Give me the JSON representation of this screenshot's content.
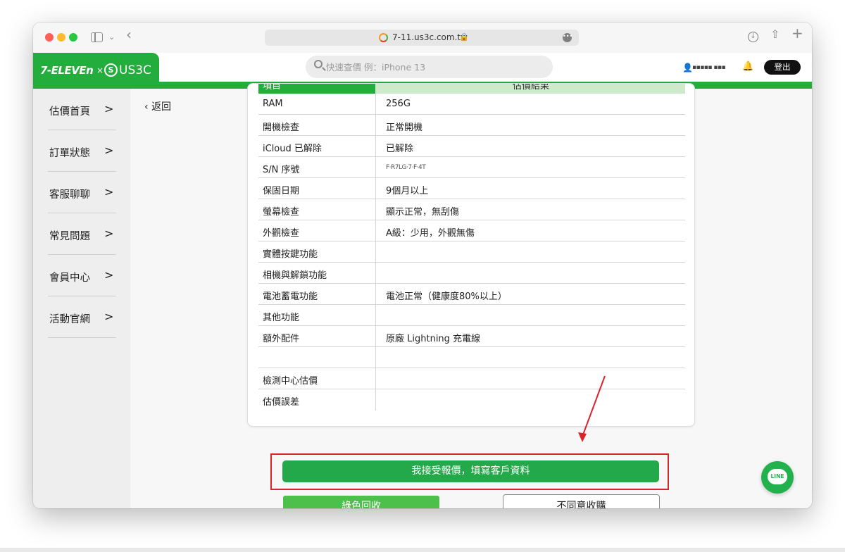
{
  "browser": {
    "url": "7-11.us3c.com.tw",
    "lock_glyph": "🔒"
  },
  "header": {
    "logo_711": "7-ELEVEn",
    "logo_x": "×",
    "logo_us3c": "US3C",
    "search_placeholder": "快速查價 例：iPhone 13",
    "logout_label": "登出"
  },
  "sidebar": {
    "items": [
      {
        "label": "估價首頁"
      },
      {
        "label": "訂單狀態"
      },
      {
        "label": "客服聊聊"
      },
      {
        "label": "常見問題"
      },
      {
        "label": "會員中心"
      },
      {
        "label": "活動官網"
      }
    ]
  },
  "content": {
    "back_label": "返回",
    "table_header": {
      "item": "項目",
      "result": "估價結果"
    },
    "rows": [
      {
        "label": "RAM",
        "value": "256G"
      },
      {
        "label": "開機檢查",
        "value": "正常開機"
      },
      {
        "label": "iCloud 已解除",
        "value": "已解除"
      },
      {
        "label": "S/N 序號",
        "value": "F·R7LG·7·F·4T"
      },
      {
        "label": "保固日期",
        "value": "9個月以上"
      },
      {
        "label": "螢幕檢查",
        "value": "顯示正常，無刮傷"
      },
      {
        "label": "外觀檢查",
        "value": "A級：少用，外觀無傷"
      },
      {
        "label": "實體按鍵功能",
        "value": ""
      },
      {
        "label": "相機與解鎖功能",
        "value": ""
      },
      {
        "label": "電池蓄電功能",
        "value": "電池正常（健康度80%以上）"
      },
      {
        "label": "其他功能",
        "value": ""
      },
      {
        "label": "額外配件",
        "value": "原廠 Lightning 充電線"
      },
      {
        "label": "",
        "value": ""
      },
      {
        "label": "檢測中心估價",
        "value": ""
      },
      {
        "label": "估價誤差",
        "value": ""
      }
    ],
    "accept_label": "我接受報價，填寫客戶資料",
    "recycle_label": "綠色回收",
    "decline_label": "不同意收購"
  },
  "line_button": {
    "label": "LINE"
  },
  "colors": {
    "brand_green": "#22ad3d",
    "button_green": "#23a84a",
    "highlight_red": "#d9252a"
  }
}
